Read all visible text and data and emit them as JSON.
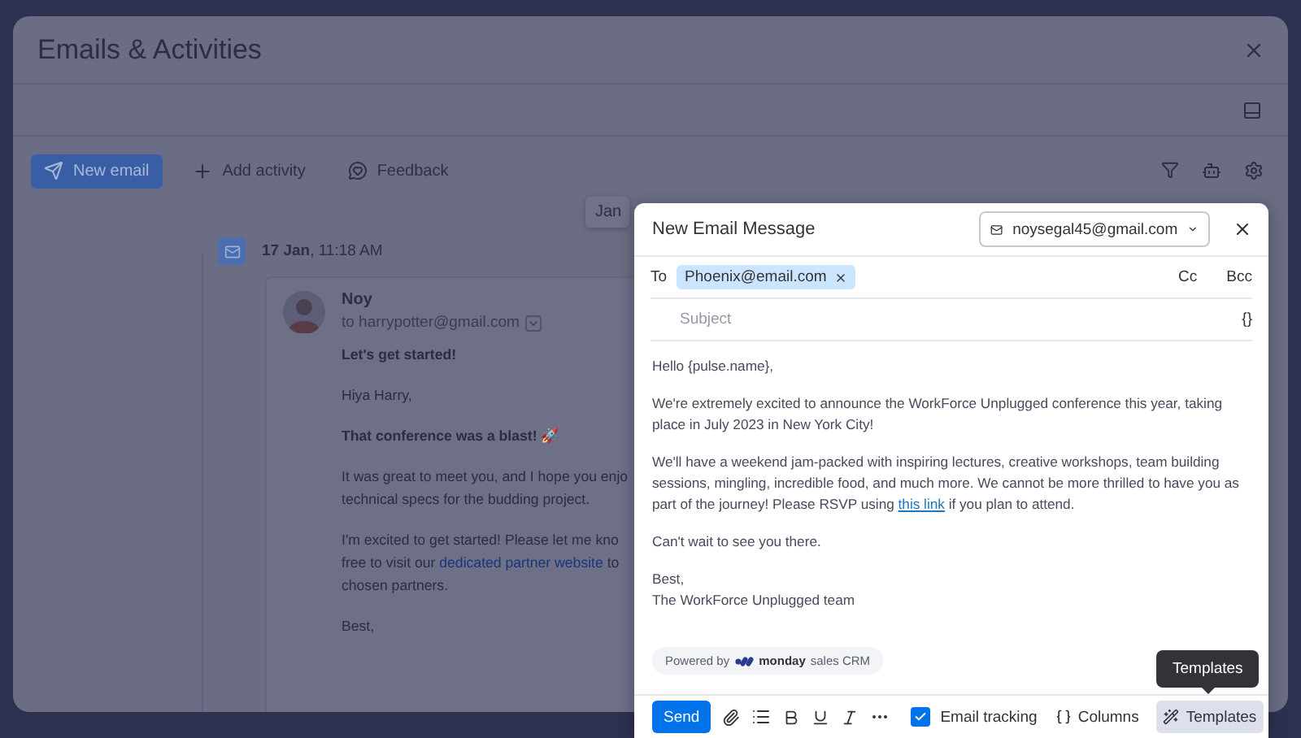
{
  "panel": {
    "title": "Emails & Activities",
    "toolbar": [
      {
        "kind": "primary",
        "label": "New email"
      },
      {
        "kind": "add",
        "label": "Add activity"
      },
      {
        "kind": "feedback",
        "label": "Feedback"
      }
    ]
  },
  "timeline": {
    "chip": "Jan",
    "date": "17 Jan",
    "time": ", 11:18 AM",
    "email": {
      "sender": "Noy",
      "recipient": "to harrypotter@gmail.com",
      "subject": "Let's get started!",
      "greeting": "Hiya Harry,",
      "headline": "That conference was a blast! 🚀",
      "paragraphs": [
        [
          {
            "text": "It was great to meet you, and I hope you enjo"
          },
          {
            "text": "technical specs for the budding project."
          }
        ],
        [
          {
            "text": "I'm excited to get started! Please let me kno"
          },
          {
            "text": "free to visit our ",
            "link": "dedicated partner website",
            "after": " to"
          },
          {
            "text": "chosen partners."
          }
        ],
        [
          {
            "text": "Best,"
          }
        ]
      ]
    }
  },
  "compose": {
    "title": "New Email Message",
    "from": "noysegal45@gmail.com",
    "to_label": "To",
    "recipients": [
      "Phoenix@email.com"
    ],
    "cc": "Cc",
    "bcc": "Bcc",
    "subject": {
      "placeholder": "Subject"
    },
    "variables": "{}",
    "body": [
      {
        "text": "Hello {pulse.name},"
      },
      {
        "text": "We're extremely excited to announce the WorkForce Unplugged conference this year, taking place in July 2023 in New York City!"
      },
      {
        "text": "We'll have a weekend jam-packed with inspiring lectures, creative workshops, team building sessions, mingling, incredible food, and much more. We cannot be more thrilled to have you as part of the journey! Please RSVP using ",
        "link": "this link",
        "after": " if you plan to attend."
      },
      {
        "text": "Can't wait to see you there."
      },
      {
        "text": "Best,\nThe WorkForce Unplugged team"
      }
    ],
    "powered": {
      "prefix": "Powered by",
      "brand": "monday",
      "suffix": "sales CRM"
    },
    "send": "Send",
    "tracking": {
      "label": "Email tracking",
      "checked": true
    },
    "columns": "Columns",
    "templates": {
      "label": "Templates",
      "selected": true
    },
    "tooltip": "Templates"
  }
}
